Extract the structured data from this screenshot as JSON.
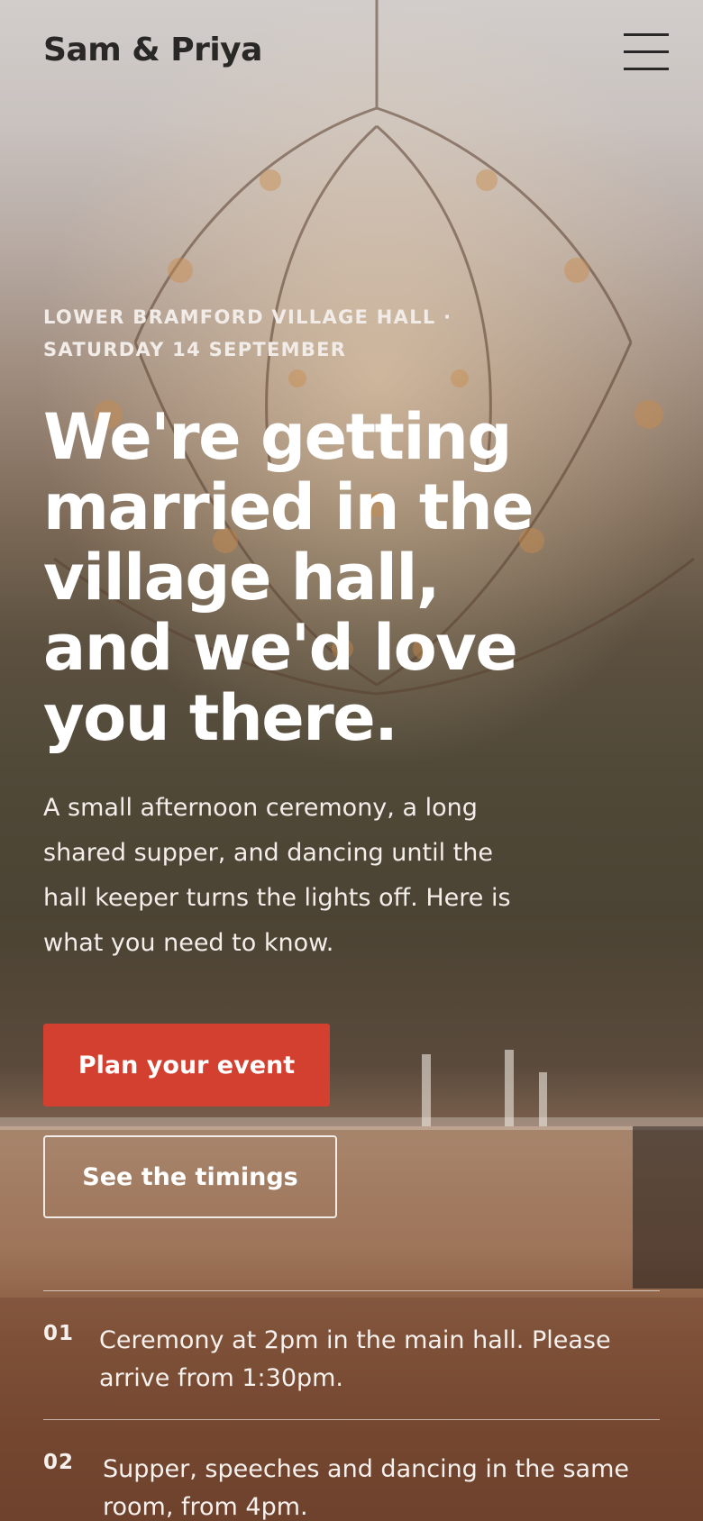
{
  "header": {
    "logo": "Sam & Priya",
    "menu_icon": "hamburger-menu-icon"
  },
  "hero": {
    "background_image": "chandelier-over-banquet-tables",
    "eyebrow": "LOWER BRAMFORD VILLAGE HALL · SATURDAY 14 SEPTEMBER",
    "headline": "We're getting married in the village hall, and we'd love you there.",
    "intro": "A small afternoon ceremony, a long shared supper, and dancing until the hall keeper turns the lights off. Here is what you need to know."
  },
  "actions": {
    "primary_label": "Plan your event",
    "secondary_label": "See the timings"
  },
  "steps": [
    {
      "number": "01",
      "text": "Ceremony at 2pm in the main hall. Please arrive from 1:30pm."
    },
    {
      "number": "02",
      "text": "Supper, speeches and dancing in the same room, from 4pm."
    }
  ],
  "colors": {
    "accent": "#d4402f",
    "logo_text": "#2a2826",
    "hero_text": "#ffffff"
  }
}
